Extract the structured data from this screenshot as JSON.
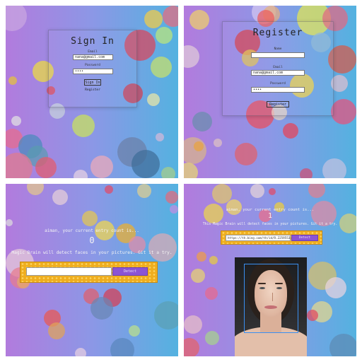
{
  "signin": {
    "title": "Sign In",
    "email_label": "Email",
    "email_value": "nana@gmail.com",
    "password_label": "Password",
    "password_value": "••••",
    "submit_label": "Sign In",
    "register_link": "Register"
  },
  "register": {
    "title": "Register",
    "name_label": "Name",
    "name_value": "",
    "email_label": "Email",
    "email_value": "nana@gmail.com",
    "password_label": "Password",
    "password_value": "••••",
    "submit_label": "Register"
  },
  "home_empty": {
    "greeting": "aiman, your current entry count is...",
    "count": "0",
    "description": "Magic Brain will detect faces in your pictures. Git it a try.",
    "url_value": "",
    "detect_label": "Detect"
  },
  "home_result": {
    "greeting": "aiman, your current entry count is...",
    "count": "1",
    "description": "This Magic Brain will detect faces in your pictures. Git it a try.",
    "url_value": "https://th.bing.com/th/id/R.2259553c",
    "detect_label": "Detect"
  },
  "colors": {
    "gradient_left": "#b27bdd",
    "gradient_right": "#54b2e0",
    "detect_button": "#8b54d4",
    "honeycomb": "#efae1f",
    "face_box": "#3a8ff0"
  }
}
